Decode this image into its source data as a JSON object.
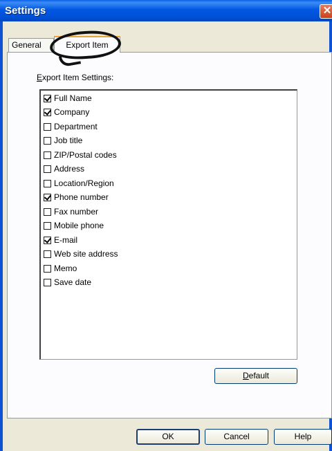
{
  "window": {
    "title": "Settings",
    "close_glyph": "✕"
  },
  "tabs": [
    {
      "label": "General"
    },
    {
      "label": "Export Item"
    }
  ],
  "section_label": {
    "prefix": "E",
    "rest": "xport Item Settings:"
  },
  "items": [
    {
      "label": "Full Name",
      "checked": true
    },
    {
      "label": "Company",
      "checked": true
    },
    {
      "label": "Department",
      "checked": false
    },
    {
      "label": "Job title",
      "checked": false
    },
    {
      "label": "ZIP/Postal codes",
      "checked": false
    },
    {
      "label": "Address",
      "checked": false
    },
    {
      "label": "Location/Region",
      "checked": false
    },
    {
      "label": "Phone number",
      "checked": true
    },
    {
      "label": "Fax number",
      "checked": false
    },
    {
      "label": "Mobile phone",
      "checked": false
    },
    {
      "label": "E-mail",
      "checked": true
    },
    {
      "label": "Web site address",
      "checked": false
    },
    {
      "label": "Memo",
      "checked": false
    },
    {
      "label": "Save date",
      "checked": false
    }
  ],
  "buttons": {
    "default_prefix": "D",
    "default_rest": "efault",
    "ok": "OK",
    "cancel": "Cancel",
    "help": "Help"
  },
  "colors": {
    "titlebar": "#0054e3",
    "accent_tab": "#e8a33a",
    "close": "#c9411a"
  }
}
